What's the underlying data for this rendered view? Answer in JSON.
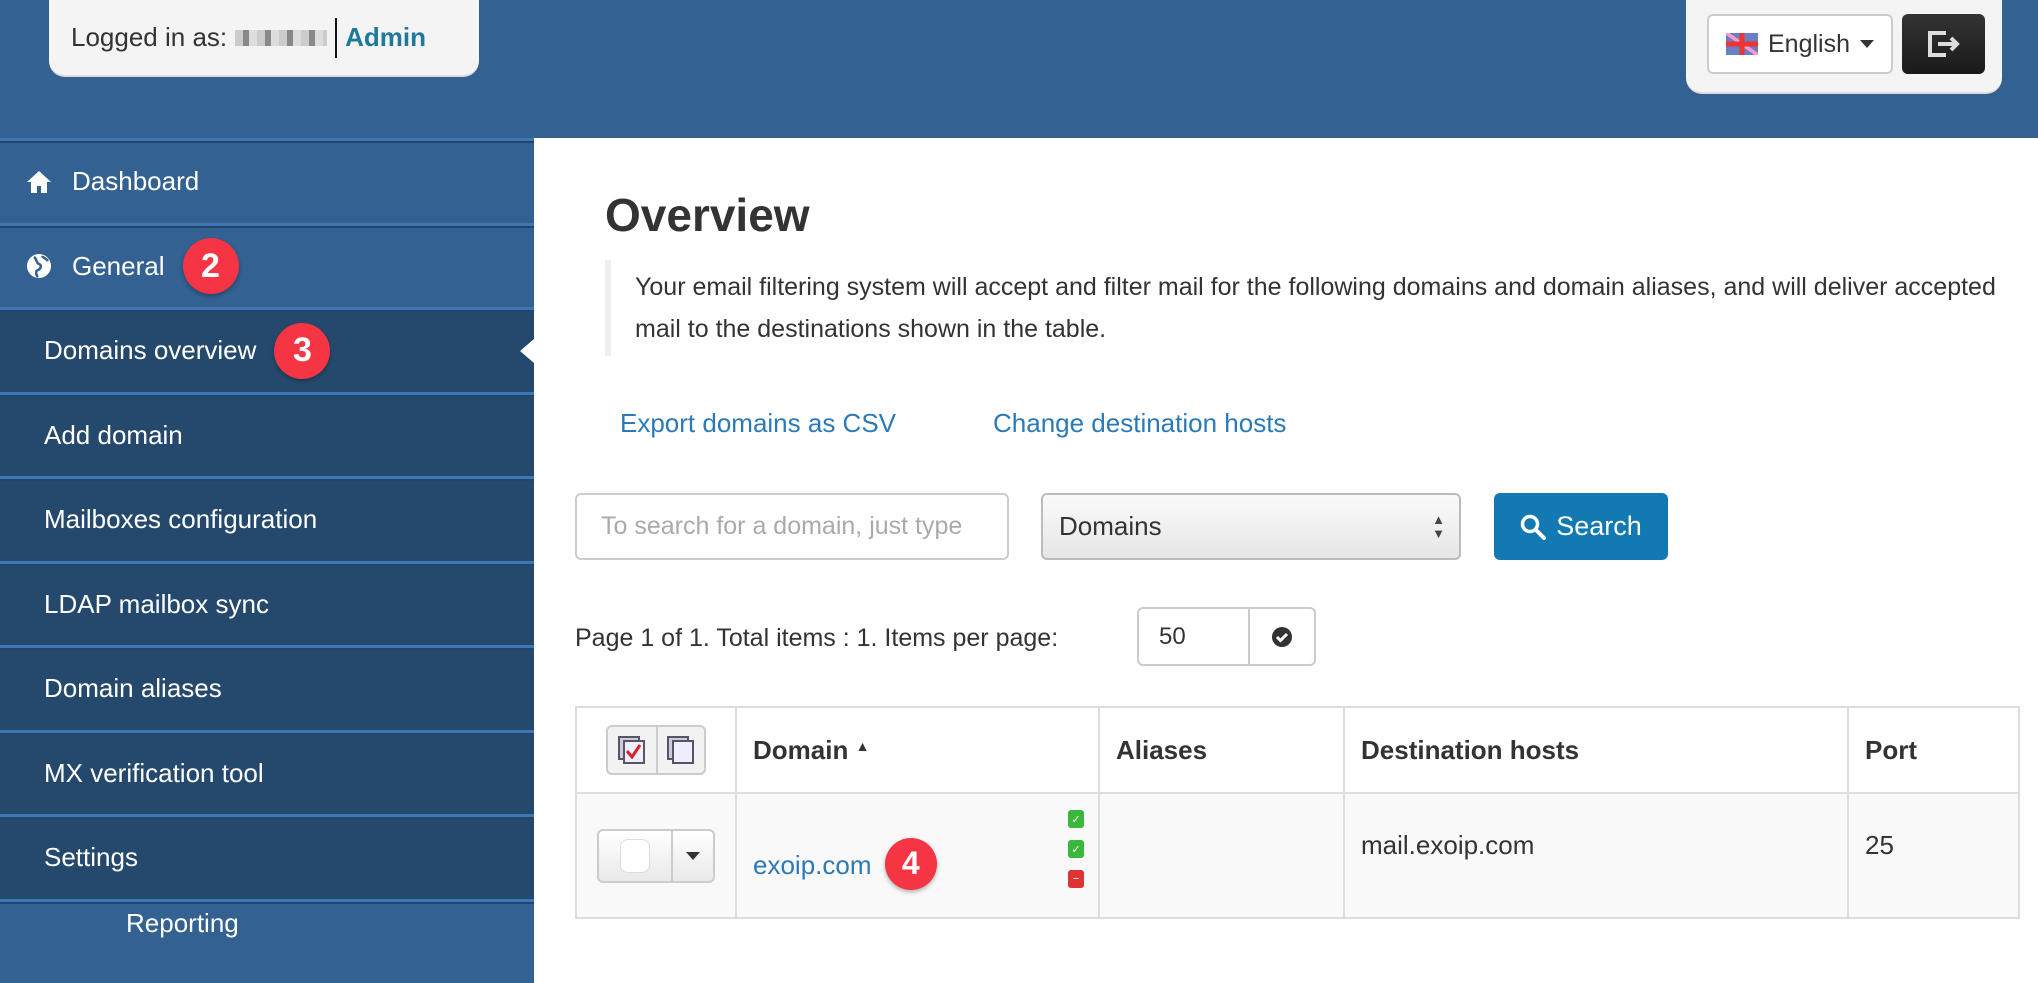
{
  "header": {
    "logged_in_label": "Logged in as:",
    "role": "Admin",
    "language": "English",
    "icons": {
      "flag": "uk-flag-icon",
      "logout": "logout-icon"
    }
  },
  "sidebar": {
    "items": [
      {
        "label": "Dashboard",
        "icon": "home-icon",
        "level": "top"
      },
      {
        "label": "General",
        "icon": "globe-icon",
        "level": "top",
        "badge": "2"
      },
      {
        "label": "Domains overview",
        "level": "sub",
        "active": true,
        "badge": "3"
      },
      {
        "label": "Add domain",
        "level": "sub"
      },
      {
        "label": "Mailboxes configuration",
        "level": "sub"
      },
      {
        "label": "LDAP mailbox sync",
        "level": "sub"
      },
      {
        "label": "Domain aliases",
        "level": "sub"
      },
      {
        "label": "MX verification tool",
        "level": "sub"
      },
      {
        "label": "Settings",
        "level": "sub"
      },
      {
        "label": "Reporting",
        "icon": "reporting-icon",
        "level": "top"
      }
    ]
  },
  "main": {
    "title": "Overview",
    "description": "Your email filtering system will accept and filter mail for the following domains and domain aliases, and will deliver accepted mail to the destinations shown in the table.",
    "links": {
      "export": "Export domains as CSV",
      "change_hosts": "Change destination hosts"
    },
    "search": {
      "placeholder": "To search for a domain, just type",
      "type_selected": "Domains",
      "button": "Search"
    },
    "pagination": {
      "info": "Page 1 of 1. Total items : 1. Items per page:",
      "per_page": "50"
    },
    "table": {
      "columns": [
        "Domain",
        "Aliases",
        "Destination hosts",
        "Port"
      ],
      "sort_column": "Domain",
      "rows": [
        {
          "domain": "exoip.com",
          "badge": "4",
          "aliases": "",
          "destination": "mail.exoip.com",
          "port": "25",
          "status": [
            "ok",
            "ok",
            "error"
          ]
        }
      ]
    }
  },
  "colors": {
    "header": "#336191",
    "submenu": "#25496d",
    "accent": "#1279b3",
    "badge": "#f53444",
    "link": "#2a7ab8"
  }
}
